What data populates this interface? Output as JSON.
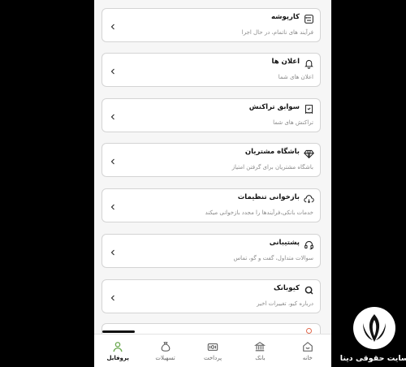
{
  "menu": [
    {
      "title": "کارپوشه",
      "subtitle": "فرآیند های ناتمام، در حال اجرا",
      "icon": "task-list-icon"
    },
    {
      "title": "اعلان ها",
      "subtitle": "اعلان های شما",
      "icon": "bell-icon"
    },
    {
      "title": "سوابق تراکنش",
      "subtitle": "تراکنش های شما",
      "icon": "receipt-icon"
    },
    {
      "title": "باشگاه مشتریان",
      "subtitle": "باشگاه مشتریان برای گرفتن امتیاز",
      "icon": "diamond-icon"
    },
    {
      "title": "بازخوانی تنظیمات",
      "subtitle": "خدمات بانکی،فرآیندها را مجدد بازخوانی میکند",
      "icon": "cloud-sync-icon"
    },
    {
      "title": "پشتیبانی",
      "subtitle": "سوالات متداول، گفت و گو، تماس",
      "icon": "headset-icon"
    },
    {
      "title": "کیوبانک",
      "subtitle": "درباره کیو، تغییرات اخیر",
      "icon": "qbank-logo-icon"
    }
  ],
  "nav": [
    {
      "label": "خانه",
      "icon": "home-icon",
      "active": false
    },
    {
      "label": "بانک",
      "icon": "bank-icon",
      "active": false
    },
    {
      "label": "پرداخت",
      "icon": "payment-icon",
      "active": false
    },
    {
      "label": "تسهیلات",
      "icon": "loan-bag-icon",
      "active": false
    },
    {
      "label": "پروفایل",
      "icon": "profile-icon",
      "active": true
    }
  ],
  "watermark": {
    "text": "سایت حقوقی دینا"
  },
  "colors": {
    "accent": "#6aa84f",
    "card_border": "#d4d4d4",
    "background": "#f6f6f6"
  }
}
